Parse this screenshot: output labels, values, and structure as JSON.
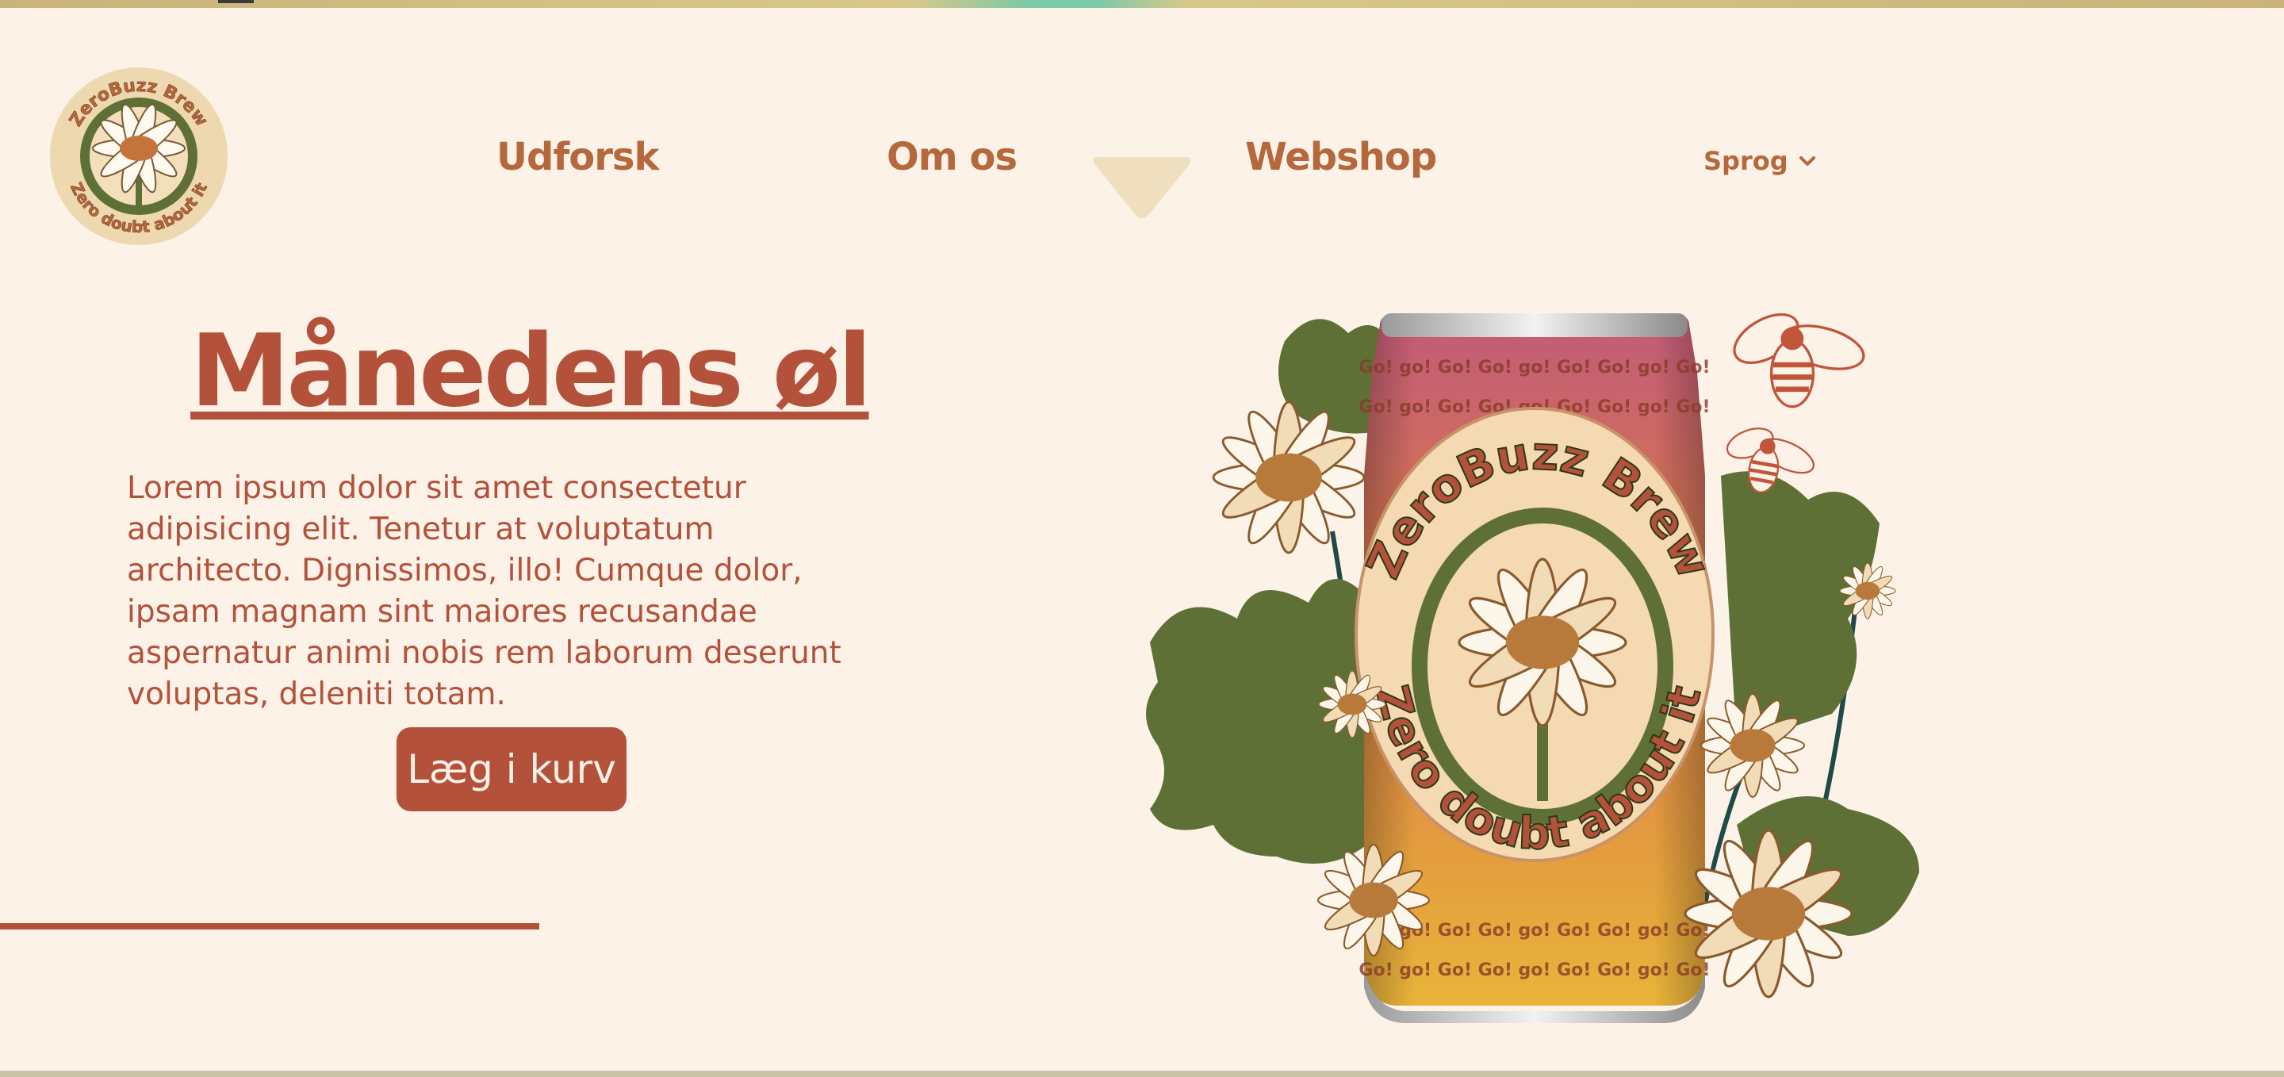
{
  "brand": {
    "logo_text_top": "ZeroBuzz Brew",
    "logo_text_bottom": "Zero doubt about it"
  },
  "nav": {
    "items": [
      {
        "label": "Udforsk"
      },
      {
        "label": "Om os"
      },
      {
        "label": "Webshop"
      }
    ],
    "language": {
      "label": "Sprog"
    }
  },
  "hero": {
    "title": "Månedens øl",
    "body": "Lorem ipsum dolor sit amet consectetur adipisicing elit. Tenetur at voluptatum architecto. Dignissimos, illo! Cumque dolor, ipsam magnam sint maiores recusandae aspernatur animi nobis rem laborum deserunt voluptas, deleniti totam.",
    "cta_label": "Læg i kurv"
  },
  "product_can": {
    "label_top": "ZeroBuzz Brew",
    "label_bottom": "Zero doubt about it",
    "pattern_text": "Go! go! Go! Go! go! Go! Go! go! Go!"
  },
  "colors": {
    "background": "#fcf2e8",
    "accent_rust": "#b4513a",
    "nav_brown": "#b5683b",
    "leaf_green": "#5f7036",
    "indicator_sand": "#efdfbf"
  },
  "icons": [
    "chevron-down-icon",
    "bee-icon",
    "daisy-icon",
    "leaf-icon"
  ]
}
